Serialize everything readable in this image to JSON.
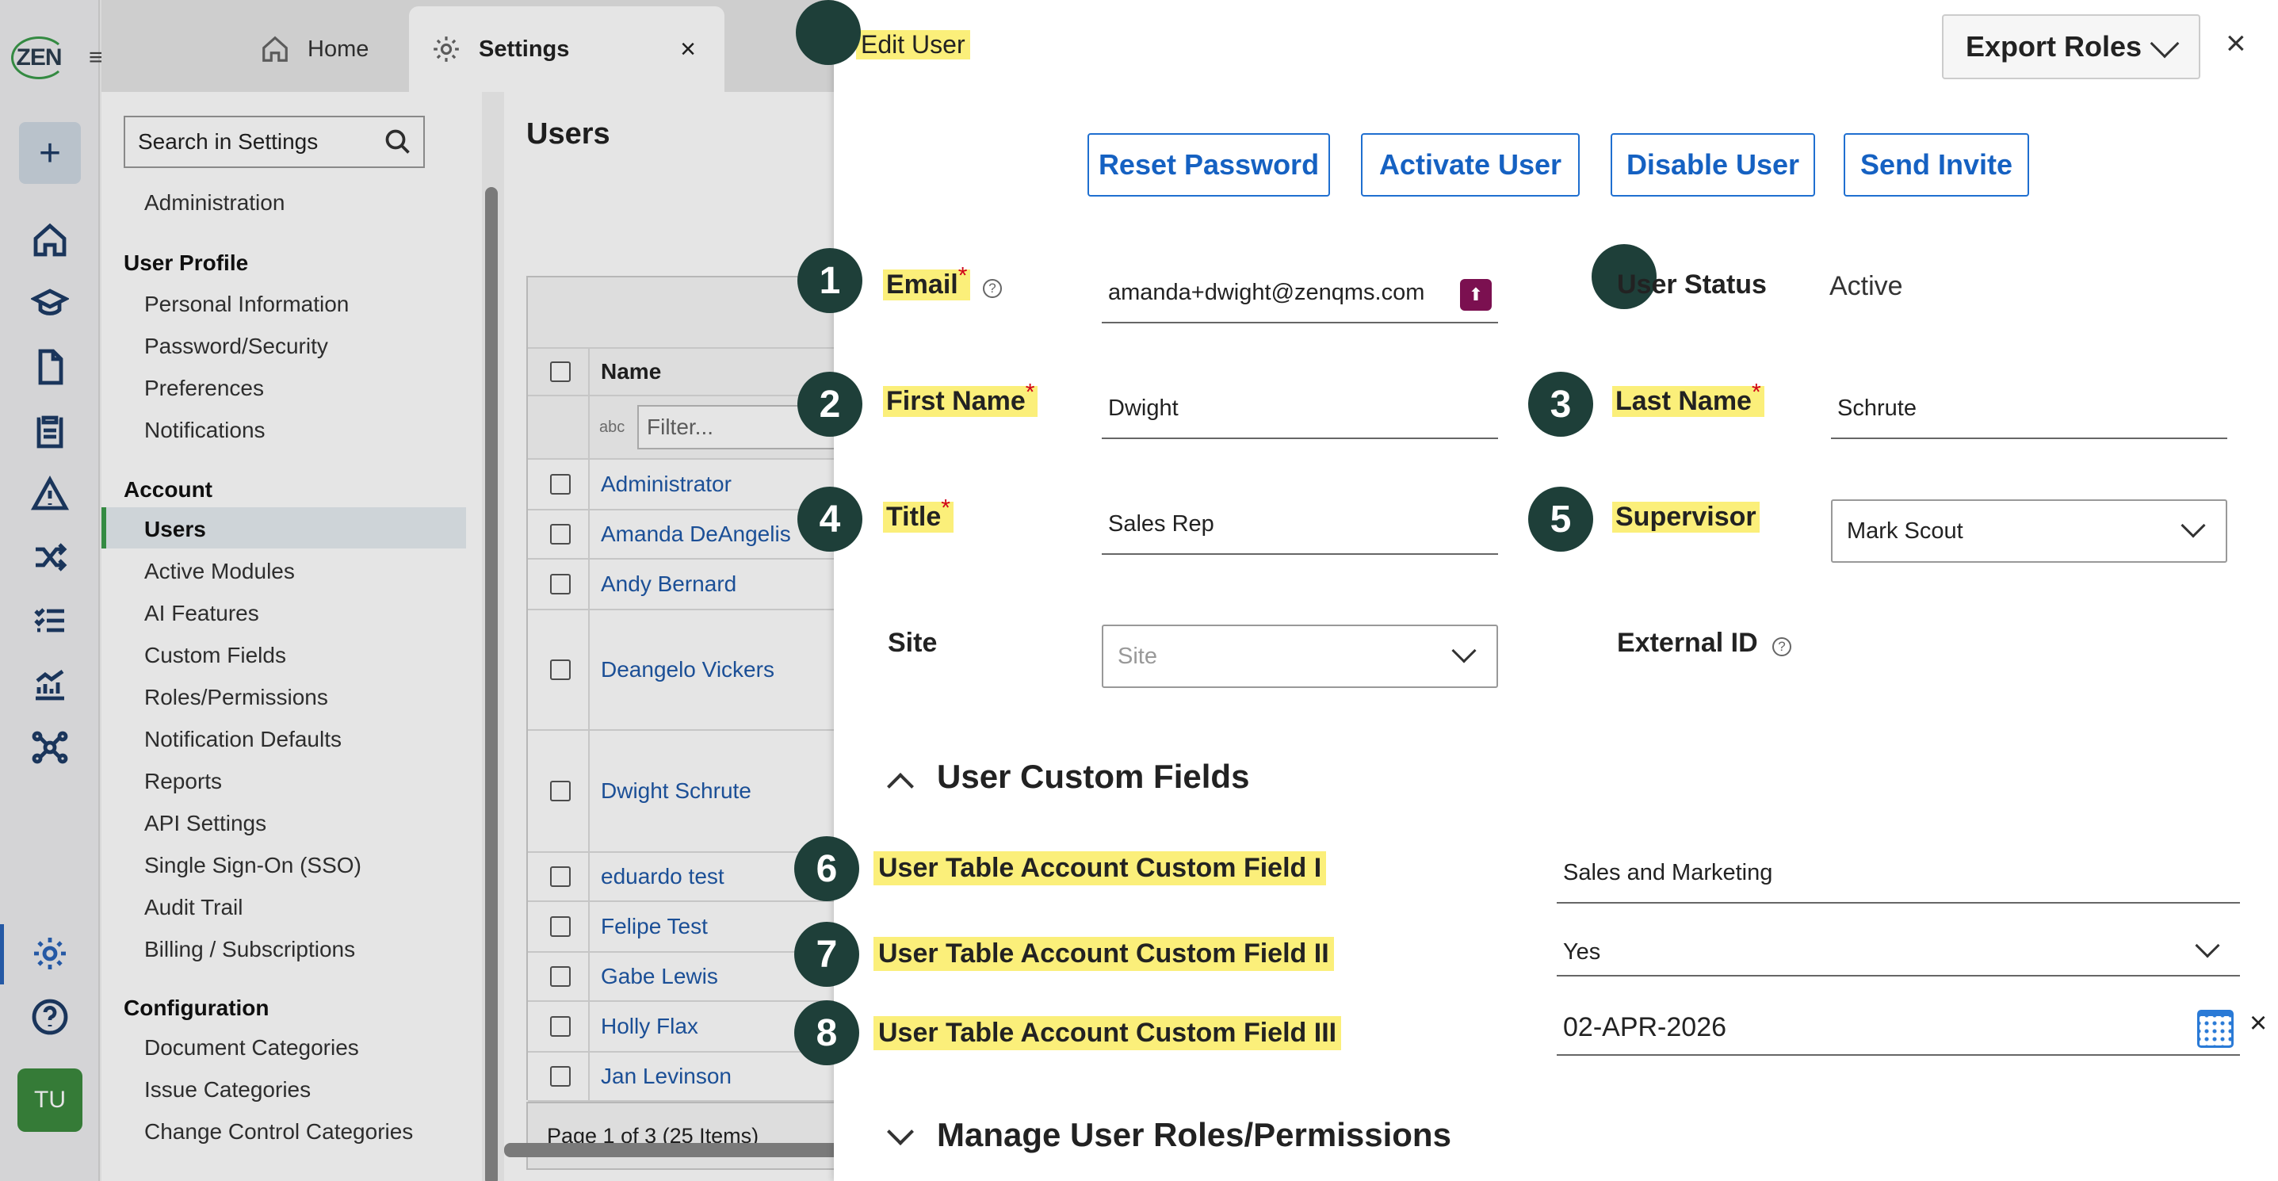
{
  "app": {
    "logo_text": "ZEN"
  },
  "tabs": {
    "home": "Home",
    "settings": "Settings"
  },
  "rail": {
    "avatar": "TU"
  },
  "sidebar": {
    "search_placeholder": "Search in Settings",
    "administration": "Administration",
    "groups": {
      "user_profile": "User Profile",
      "account": "Account",
      "configuration": "Configuration"
    },
    "user_profile_items": [
      "Personal Information",
      "Password/Security",
      "Preferences",
      "Notifications"
    ],
    "account_items": [
      "Users",
      "Active Modules",
      "AI Features",
      "Custom Fields",
      "Roles/Permissions",
      "Notification Defaults",
      "Reports",
      "API Settings",
      "Single Sign-On (SSO)",
      "Audit Trail",
      "Billing / Subscriptions"
    ],
    "configuration_items": [
      "Document Categories",
      "Issue Categories",
      "Change Control Categories"
    ]
  },
  "users": {
    "title": "Users",
    "name_header": "Name",
    "filter_placeholder": "Filter...",
    "filter_icon": "abc",
    "rows": [
      "Administrator",
      "Amanda DeAngelis",
      "Andy Bernard",
      "Deangelo Vickers",
      "Dwight Schrute",
      "eduardo test",
      "Felipe Test",
      "Gabe Lewis",
      "Holly Flax",
      "Jan Levinson"
    ],
    "pager": "Page 1 of 3 (25 Items)"
  },
  "panel": {
    "title": "Edit User",
    "export_label": "Export Roles",
    "buttons": {
      "reset": "Reset Password",
      "activate": "Activate User",
      "disable": "Disable User",
      "invite": "Send Invite"
    },
    "fields": {
      "email": {
        "label": "Email",
        "value": "amanda+dwight@zenqms.com"
      },
      "user_status": {
        "label": "User Status",
        "value": "Active"
      },
      "first_name": {
        "label": "First Name",
        "value": "Dwight"
      },
      "last_name": {
        "label": "Last Name",
        "value": "Schrute"
      },
      "title": {
        "label": "Title",
        "value": "Sales Rep"
      },
      "supervisor": {
        "label": "Supervisor",
        "value": "Mark Scout"
      },
      "site": {
        "label": "Site",
        "placeholder": "Site"
      },
      "external_id": {
        "label": "External ID"
      }
    },
    "required_mark": "*",
    "help_mark": "?",
    "custom_section": "User Custom Fields",
    "custom_fields": [
      {
        "label": "User Table Account Custom Field I",
        "value": "Sales and Marketing"
      },
      {
        "label": "User Table Account Custom Field II",
        "value": "Yes"
      },
      {
        "label": "User Table Account Custom Field III",
        "value": "02-APR-2026"
      }
    ],
    "roles_section": "Manage User Roles/Permissions",
    "badges": [
      "1",
      "2",
      "3",
      "4",
      "5",
      "6",
      "7",
      "8"
    ]
  },
  "colors": {
    "highlight": "#fbef7a",
    "badge": "#1e3f39",
    "link": "#1f58a8",
    "accent": "#1f6fd0",
    "required": "#d0021b"
  }
}
